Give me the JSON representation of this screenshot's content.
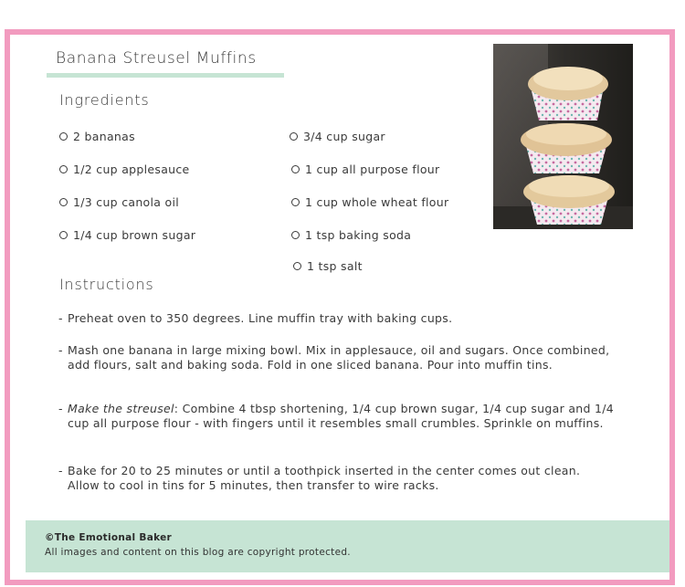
{
  "recipe": {
    "title": "Banana Streusel Muffins",
    "ingredients_heading": "Ingredients",
    "ingredients_left": [
      "2 bananas",
      "1/2 cup applesauce",
      "1/3 cup canola oil",
      "1/4 cup brown sugar"
    ],
    "ingredients_right": [
      "3/4 cup sugar",
      "1 cup all purpose flour",
      "1 cup whole wheat flour",
      "1 tsp baking soda",
      "1 tsp salt"
    ],
    "instructions_heading": "Instructions",
    "steps": {
      "step1": "Preheat oven to 350 degrees. Line muffin tray with baking cups.",
      "step2": "Mash one banana in large mixing bowl. Mix in applesauce, oil and sugars. Once combined, add flours, salt and baking soda. Fold in one sliced banana. Pour into muffin tins.",
      "step3_italic": "Make the streusel",
      "step3_rest": ": Combine 4 tbsp shortening, 1/4 cup brown sugar, 1/4 cup sugar and 1/4 cup all purpose flour - with fingers until it resembles small crumbles. Sprinkle on muffins.",
      "step4": "Bake for 20 to 25 minutes or until a toothpick inserted in the center comes out clean. Allow to cool in tins for 5 minutes, then transfer to wire racks."
    }
  },
  "footer": {
    "copyright": "©The Emotional Baker",
    "notice": "All images and content on this blog are copyright protected."
  },
  "colors": {
    "border_pink": "#f29bbf",
    "accent_mint": "#c6e4d4",
    "text": "#3a3a3a"
  }
}
